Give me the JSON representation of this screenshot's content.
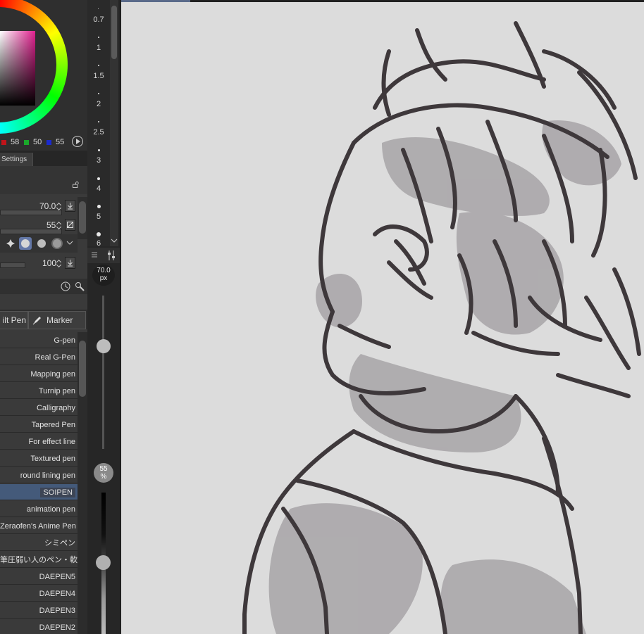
{
  "color": {
    "r_value": "58",
    "g_value": "50",
    "b_value": "55",
    "r_color": "#c0141a",
    "g_color": "#1aa82a",
    "b_color": "#1a2ad0",
    "main_color": "#3a3237"
  },
  "tool_property": {
    "tab_label": "Settings",
    "brush_size": "70.0",
    "opacity": "55",
    "density": "100"
  },
  "brush_group_tabs": [
    "ilt Pen",
    "Marker"
  ],
  "brushes": [
    "G-pen",
    "Real G-Pen",
    "Mapping pen",
    "Turnip pen",
    "Calligraphy",
    "Tapered Pen",
    "For effect line",
    "Textured pen",
    "round lining pen",
    "SOIPEN",
    "animation pen",
    "Zeraofen's Anime Pen",
    "シミペン",
    "筆圧弱い人のペン・軟",
    "DAEPEN5",
    "DAEPEN4",
    "DAEPEN3",
    "DAEPEN2"
  ],
  "selected_brush": "SOIPEN",
  "brush_sizes": [
    "0.7",
    "1",
    "1.5",
    "2",
    "2.5",
    "3",
    "4",
    "5",
    "6"
  ],
  "size_readout": {
    "value": "70.0",
    "unit": "px"
  },
  "opacity_badge": {
    "value": "55",
    "unit": "%"
  },
  "canvas": {
    "background": "#dcdcdc",
    "ink": "#3e383b",
    "shade": "#a09da0"
  }
}
